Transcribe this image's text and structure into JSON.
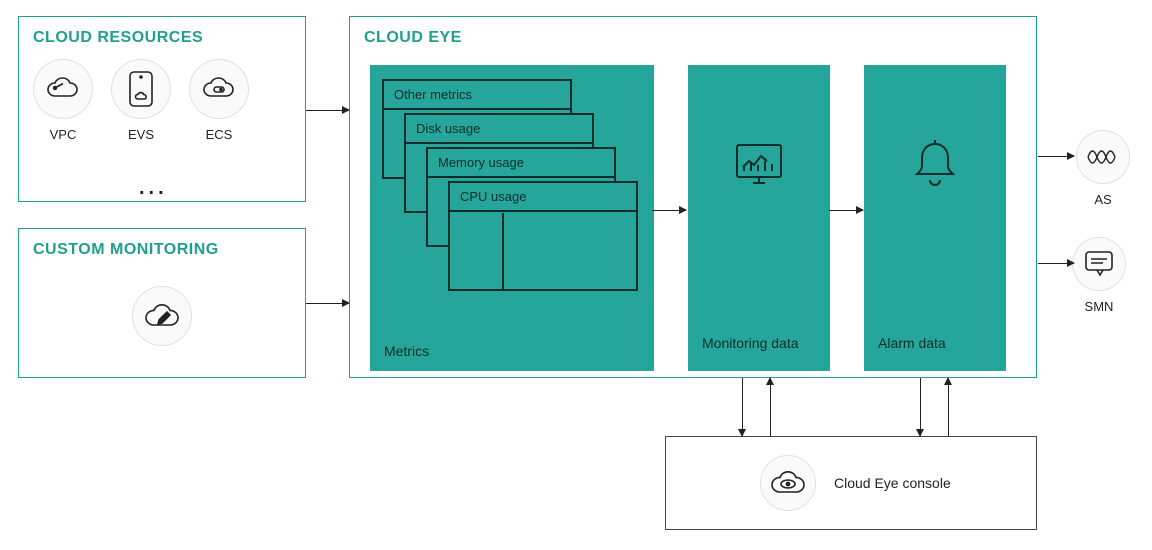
{
  "cloud_resources": {
    "title": "CLOUD RESOURCES",
    "items": [
      {
        "label": "VPC"
      },
      {
        "label": "EVS"
      },
      {
        "label": "ECS"
      }
    ],
    "ellipsis": "..."
  },
  "custom_monitoring": {
    "title": "CUSTOM MONITORING"
  },
  "cloud_eye": {
    "title": "CLOUD EYE",
    "metrics": {
      "caption": "Metrics",
      "layers": [
        "Other metrics",
        "Disk usage",
        "Memory usage",
        "CPU usage"
      ]
    },
    "monitoring": {
      "caption": "Monitoring data"
    },
    "alarm": {
      "caption": "Alarm data"
    }
  },
  "outputs": {
    "as": "AS",
    "smn": "SMN"
  },
  "console": {
    "label": "Cloud Eye console"
  }
}
